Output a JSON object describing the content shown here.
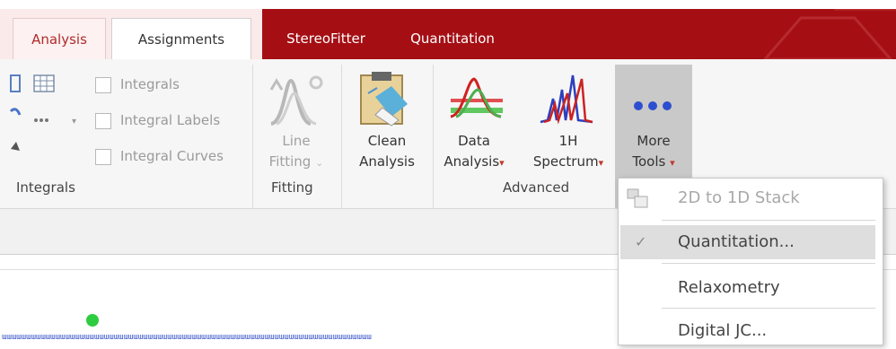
{
  "tabs": [
    {
      "label": "Analysis"
    },
    {
      "label": "Assignments"
    },
    {
      "label": "StereoFitter"
    },
    {
      "label": "Quantitation"
    }
  ],
  "integrals_group": {
    "checkboxes": [
      "Integrals",
      "Integral Labels",
      "Integral Curves"
    ],
    "label": "Integrals"
  },
  "fitting_group": {
    "line_fitting": {
      "line1": "Line",
      "line2": "Fitting"
    },
    "label": "Fitting"
  },
  "clean_analysis": {
    "line1": "Clean",
    "line2": "Analysis"
  },
  "advanced_group": {
    "data_analysis": {
      "line1": "Data",
      "line2": "Analysis"
    },
    "spectrum_1h": {
      "line1": "1H",
      "line2": "Spectrum"
    },
    "more_tools": {
      "line1": "More",
      "line2": "Tools"
    },
    "label": "Advanced"
  },
  "dropdown": {
    "items": [
      {
        "label": "2D to 1D Stack",
        "enabled": false
      },
      {
        "label": "Quantitation...",
        "checked": true
      },
      {
        "label": "Relaxometry"
      },
      {
        "label": "Digital JC..."
      }
    ]
  },
  "axis_ticks": "ᵊᵊᵊᵊᵊᵊᵊᵊᵊᵊᵊᵊᵊᵊᵊᵊᵊᵊᵊᵊᵊᵊᵊᵊᵊᵊᵊᵊᵊᵊᵊᵊᵊᵊᵊᵊᵊᵊᵊᵊᵊᵊᵊᵊᵊᵊᵊᵊᵊᵊᵊᵊᵊᵊᵊᵊᵊᵊᵊᵊᵊᵊᵊᵊᵊ",
  "colors": {
    "brand_red": "#a50f14",
    "accent_red": "#c0392b",
    "peak_green": "#2ecc40"
  }
}
